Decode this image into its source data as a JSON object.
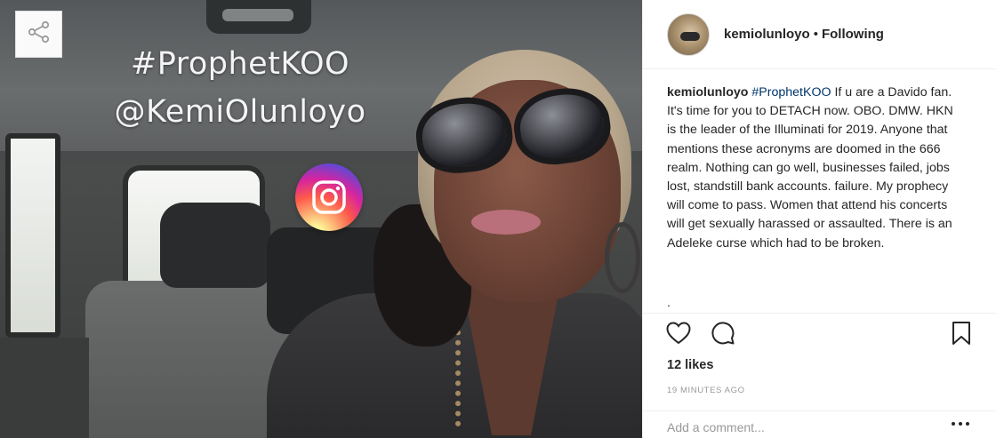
{
  "post": {
    "image": {
      "overlay_hashtag": "#ProphetKOO",
      "overlay_handle": "@KemiOlunloyo",
      "badge_icon": "instagram-icon",
      "share_icon": "share-icon"
    },
    "header": {
      "username": "kemiolunloyo",
      "separator": "•",
      "follow_status": "Following",
      "avatar_icon": "avatar"
    },
    "caption": {
      "username": "kemiolunloyo",
      "hashtag": "#ProphetKOO",
      "text": "If u are a Davido fan. It's time for you to DETACH now. OBO. DMW. HKN is the leader of the Illuminati for 2019. Anyone that mentions these acronyms are doomed in the 666 realm. Nothing can go well, businesses failed, jobs lost, standstill bank accounts. failure. My prophecy will come to pass. Women that attend his concerts will get sexually harassed or assaulted. There is an Adeleke curse which had to be broken.",
      "trailing": "."
    },
    "actions": {
      "like_icon": "heart-icon",
      "comment_icon": "comment-icon",
      "save_icon": "bookmark-icon"
    },
    "likes": "12 likes",
    "timestamp": "19 MINUTES AGO",
    "comment": {
      "placeholder": "Add a comment...",
      "more_icon": "more-icon"
    }
  },
  "colors": {
    "hashtag_link": "#003569",
    "text": "#262626",
    "muted": "#999999",
    "border": "#efefef"
  }
}
